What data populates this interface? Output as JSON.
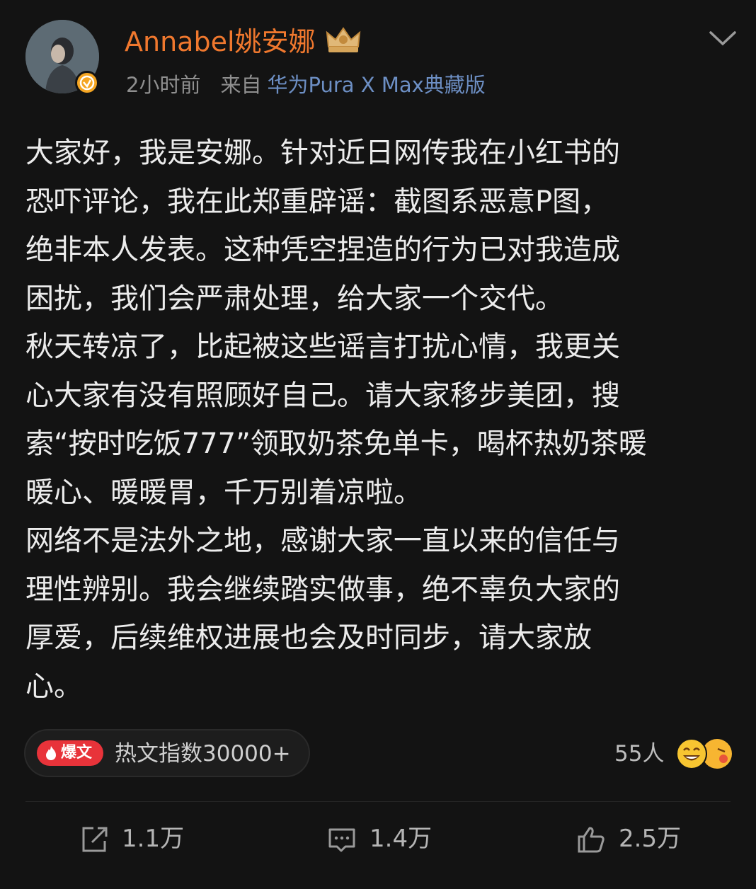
{
  "post": {
    "author": "Annabel姚安娜",
    "time": "2小时前",
    "source_prefix": "来自",
    "source_device": "华为Pura X Max典藏版",
    "lines": [
      "大家好，我是安娜。针对近日网传我在小红书的",
      "恐吓评论，我在此郑重辟谣：截图系恶意P图，",
      "绝非本人发表。这种凭空捏造的行为已对我造成",
      "困扰，我们会严肃处理，给大家一个交代。",
      "秋天转凉了，比起被这些谣言打扰心情，我更关",
      "心大家有没有照顾好自己。请大家移步美团，搜",
      "索“按时吃饭777”领取奶茶免单卡，喝杯热奶茶暖",
      "暖心、暖暖胃，千万别着凉啦。",
      "网络不是法外之地，感谢大家一直以来的信任与",
      "理性辨别。我会继续踏实做事，绝不辜负大家的",
      "厚爱，后续维权进展也会及时同步，请大家放",
      "心。"
    ]
  },
  "hot": {
    "tag": "爆文",
    "text": "热文指数30000+"
  },
  "reactions": {
    "count": "55人"
  },
  "actions": {
    "repost": "1.1万",
    "comment": "1.4万",
    "like": "2.5万"
  },
  "colors": {
    "background": "#131313",
    "author": "#f0782e",
    "device": "#6d8fc4",
    "hot_tag": "#e8333a",
    "verified": "#f5a623"
  }
}
